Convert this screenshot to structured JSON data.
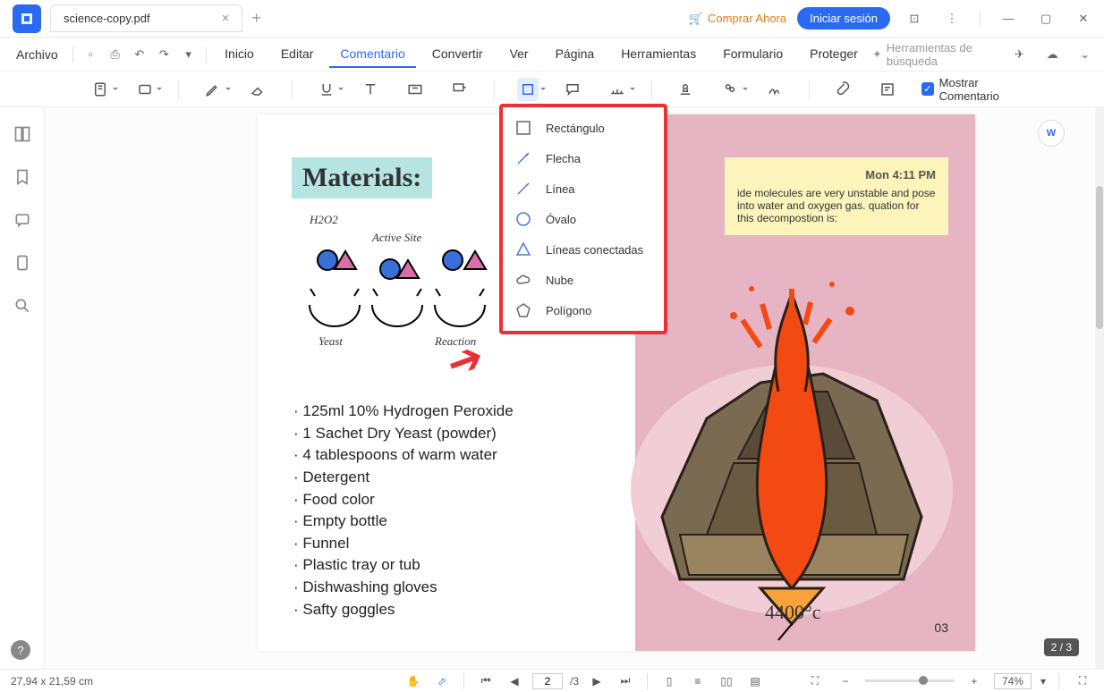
{
  "titlebar": {
    "tab_name": "science-copy.pdf",
    "buy": "Comprar Ahora",
    "signin": "Iniciar sesión"
  },
  "menubar": {
    "file": "Archivo",
    "items": [
      "Inicio",
      "Editar",
      "Comentario",
      "Convertir",
      "Ver",
      "Página",
      "Herramientas",
      "Formulario",
      "Proteger"
    ],
    "active_index": 2,
    "ai_tools": "Herramientas de búsqueda"
  },
  "toolbar": {
    "show_comment": "Mostrar Comentario"
  },
  "shapes_dropdown": {
    "items": [
      {
        "icon": "rect",
        "label": "Rectángulo"
      },
      {
        "icon": "arrow",
        "label": "Flecha"
      },
      {
        "icon": "line",
        "label": "Línea"
      },
      {
        "icon": "oval",
        "label": "Óvalo"
      },
      {
        "icon": "polyline",
        "label": "Líneas conectadas"
      },
      {
        "icon": "cloud",
        "label": "Nube"
      },
      {
        "icon": "polygon",
        "label": "Polígono"
      }
    ]
  },
  "document": {
    "materials_title": "Materials:",
    "h202_labels": {
      "h202": "H2O2",
      "active_site": "Active Site",
      "yeast": "Yeast",
      "reaction": "Reaction"
    },
    "materials_list": [
      "125ml 10% Hydrogen Peroxide",
      "1 Sachet Dry Yeast (powder)",
      "4 tablespoons of warm water",
      "Detergent",
      "Food color",
      "Empty bottle",
      "Funnel",
      "Plastic tray or tub",
      "Dishwashing gloves",
      "Safty goggles"
    ],
    "note": {
      "timestamp": "Mon 4:11 PM",
      "body": "ide molecules are very unstable and pose into water and oxygen gas. quation for this decompostion is:"
    },
    "volcano_temp": "4400°c",
    "page_number": "03"
  },
  "page_badge": "2 / 3",
  "statusbar": {
    "coords": "27,94 x 21,59 cm",
    "page_current": "2",
    "page_total": "/3",
    "zoom": "74%"
  }
}
